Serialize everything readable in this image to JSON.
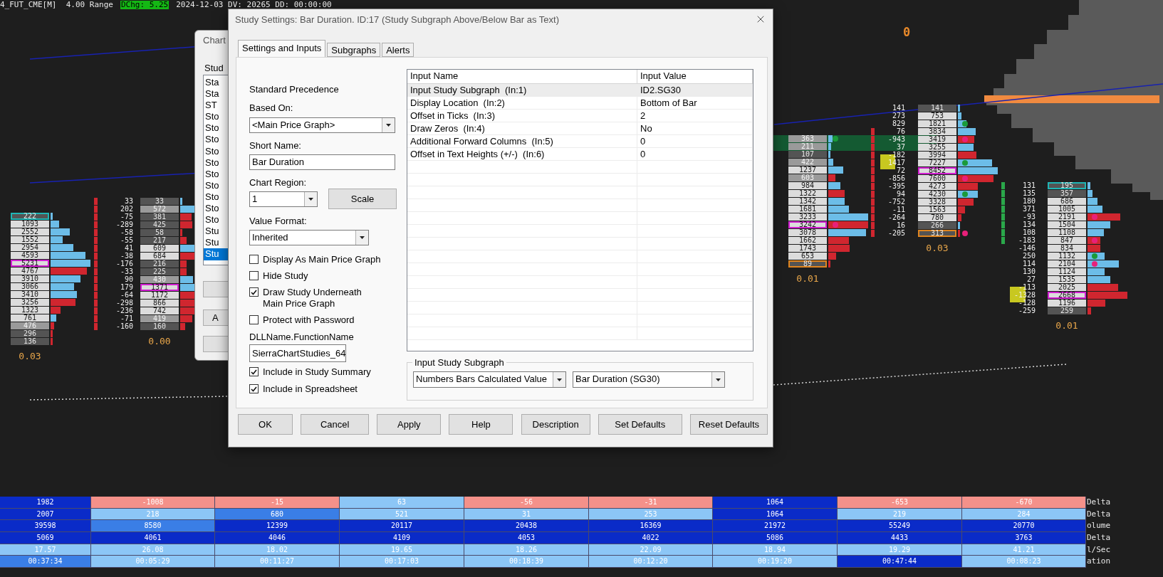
{
  "chart": {
    "header": {
      "symbol": "4_FUT_CME[M]  4.00 Range",
      "change": "DChg: 5.25",
      "info": "2024-12-03 DV: 20265 DD: 00:00:00"
    },
    "marker": "0",
    "footprints": [
      {
        "label": "0.03",
        "rows": [
          {
            "volume": "222",
            "kind": "open",
            "cell": {
              "color": "#545454"
            },
            "bar": {
              "color": "#6cbde8"
            }
          },
          {
            "volume": "1093",
            "kind": "plain",
            "cell": {
              "color": "#dcdcdc"
            },
            "bar": {
              "color": "#6cbde8"
            }
          },
          {
            "volume": "2552",
            "kind": "plain",
            "cell": {
              "color": "#dcdcdc"
            },
            "bar": {
              "color": "#6cbde8"
            }
          },
          {
            "volume": "1552",
            "kind": "plain",
            "cell": {
              "color": "#dcdcdc"
            },
            "bar": {
              "color": "#6cbde8"
            }
          },
          {
            "volume": "2954",
            "kind": "plain",
            "cell": {
              "color": "#dcdcdc"
            },
            "bar": {
              "color": "#6cbde8"
            }
          },
          {
            "volume": "4593",
            "kind": "plain",
            "cell": {
              "color": "#dcdcdc"
            },
            "bar": {
              "color": "#6cbde8"
            }
          },
          {
            "volume": "5231",
            "kind": "poc",
            "cell": {
              "color": "#dcdcdc"
            },
            "bar": {
              "color": "#6cbde8"
            }
          },
          {
            "volume": "4767",
            "kind": "plain",
            "cell": {
              "color": "#dcdcdc"
            },
            "bar": {
              "color": "#d0262f"
            }
          },
          {
            "volume": "3910",
            "kind": "plain",
            "cell": {
              "color": "#dcdcdc"
            },
            "bar": {
              "color": "#6cbde8"
            }
          },
          {
            "volume": "3066",
            "kind": "plain",
            "cell": {
              "color": "#dcdcdc"
            },
            "bar": {
              "color": "#6cbde8"
            }
          },
          {
            "volume": "3410",
            "kind": "plain",
            "cell": {
              "color": "#dcdcdc"
            },
            "bar": {
              "color": "#6cbde8"
            }
          },
          {
            "volume": "3256",
            "kind": "plain",
            "cell": {
              "color": "#dcdcdc"
            },
            "bar": {
              "color": "#d0262f"
            }
          },
          {
            "volume": "1323",
            "kind": "plain",
            "cell": {
              "color": "#dcdcdc"
            },
            "bar": {
              "color": "#d0262f"
            }
          },
          {
            "volume": "761",
            "kind": "plain",
            "cell": {
              "color": "#dcdcdc"
            },
            "bar": {
              "color": "#6cbde8"
            }
          },
          {
            "volume": "476",
            "kind": "plain",
            "cell": {
              "color": "#9a9a9a"
            },
            "bar": {
              "color": "#d0262f"
            }
          },
          {
            "volume": "296",
            "kind": "plain",
            "cell": {
              "color": "#545454"
            },
            "bar": {
              "color": "#d0262f"
            }
          },
          {
            "volume": "136",
            "kind": "plain",
            "cell": {
              "color": "#545454"
            },
            "bar": {
              "color": "#d0262f"
            }
          }
        ]
      },
      {
        "label": "0.00",
        "rows": [
          {
            "delta": "33",
            "volume": "33",
            "kind": "plain",
            "cell": {
              "color": "#545454"
            },
            "bar": {
              "color": "#6cbde8"
            }
          },
          {
            "delta": "202",
            "volume": "572",
            "kind": "plain",
            "cell": {
              "color": "#9a9a9a"
            },
            "bar": {
              "color": "#6cbde8"
            }
          },
          {
            "delta": "-75",
            "volume": "381",
            "kind": "plain",
            "cell": {
              "color": "#545454"
            },
            "bar": {
              "color": "#d0262f"
            }
          },
          {
            "delta": "-289",
            "volume": "425",
            "kind": "plain",
            "cell": {
              "color": "#545454"
            },
            "bar": {
              "color": "#d0262f"
            }
          },
          {
            "delta": "-58",
            "volume": "58",
            "kind": "plain",
            "cell": {
              "color": "#545454"
            },
            "bar": {
              "color": "#d0262f"
            }
          },
          {
            "delta": "-55",
            "volume": "217",
            "kind": "plain",
            "cell": {
              "color": "#545454"
            },
            "bar": {
              "color": "#d0262f"
            }
          },
          {
            "delta": "41",
            "volume": "609",
            "kind": "plain",
            "cell": {
              "color": "#dcdcdc"
            },
            "bar": {
              "color": "#6cbde8"
            }
          },
          {
            "delta": "-38",
            "volume": "684",
            "kind": "plain",
            "cell": {
              "color": "#dcdcdc"
            },
            "bar": {
              "color": "#d0262f"
            }
          },
          {
            "delta": "-176",
            "volume": "216",
            "kind": "plain",
            "cell": {
              "color": "#545454"
            },
            "bar": {
              "color": "#d0262f"
            }
          },
          {
            "delta": "-33",
            "volume": "225",
            "kind": "plain",
            "cell": {
              "color": "#545454"
            },
            "bar": {
              "color": "#d0262f"
            }
          },
          {
            "delta": "90",
            "volume": "430",
            "kind": "plain",
            "cell": {
              "color": "#9a9a9a"
            },
            "bar": {
              "color": "#6cbde8"
            }
          },
          {
            "delta": "179",
            "volume": "1371",
            "kind": "poc",
            "cell": {
              "color": "#dcdcdc"
            },
            "bar": {
              "color": "#6cbde8"
            }
          },
          {
            "delta": "-64",
            "volume": "1172",
            "kind": "plain",
            "cell": {
              "color": "#dcdcdc"
            },
            "bar": {
              "color": "#d0262f"
            }
          },
          {
            "delta": "-298",
            "volume": "866",
            "kind": "plain",
            "cell": {
              "color": "#dcdcdc"
            },
            "bar": {
              "color": "#d0262f"
            }
          },
          {
            "delta": "-236",
            "volume": "742",
            "kind": "plain",
            "cell": {
              "color": "#dcdcdc"
            },
            "bar": {
              "color": "#d0262f"
            }
          },
          {
            "delta": "-71",
            "volume": "419",
            "kind": "plain",
            "cell": {
              "color": "#9a9a9a"
            },
            "bar": {
              "color": "#d0262f"
            }
          },
          {
            "delta": "-160",
            "volume": "160",
            "kind": "plain",
            "cell": {
              "color": "#545454"
            },
            "bar": {
              "color": "#d0262f"
            }
          }
        ]
      },
      {
        "label": "0.01",
        "rows": [
          {
            "volume": "363",
            "kind": "plain",
            "cell": {
              "color": "#9a9a9a"
            },
            "bar": {
              "color": "#6cbde8"
            },
            "dot": {
              "color": "#1a9a3a"
            }
          },
          {
            "volume": "211",
            "kind": "plain",
            "cell": {
              "color": "#9a9a9a"
            },
            "bar": {
              "color": "#6cbde8"
            }
          },
          {
            "volume": "107",
            "kind": "plain",
            "cell": {
              "color": "#545454"
            },
            "bar": {
              "color": "#6cbde8"
            }
          },
          {
            "volume": "422",
            "kind": "plain",
            "cell": {
              "color": "#9a9a9a"
            },
            "bar": {
              "color": "#6cbde8"
            }
          },
          {
            "volume": "1237",
            "kind": "plain",
            "cell": {
              "color": "#dcdcdc"
            },
            "bar": {
              "color": "#6cbde8"
            }
          },
          {
            "volume": "603",
            "kind": "plain",
            "cell": {
              "color": "#9a9a9a"
            },
            "bar": {
              "color": "#d0262f"
            }
          },
          {
            "volume": "984",
            "kind": "plain",
            "cell": {
              "color": "#dcdcdc"
            },
            "bar": {
              "color": "#6cbde8"
            }
          },
          {
            "volume": "1322",
            "kind": "plain",
            "cell": {
              "color": "#dcdcdc"
            },
            "bar": {
              "color": "#d0262f"
            }
          },
          {
            "volume": "1342",
            "kind": "plain",
            "cell": {
              "color": "#dcdcdc"
            },
            "bar": {
              "color": "#6cbde8"
            }
          },
          {
            "volume": "1681",
            "kind": "plain",
            "cell": {
              "color": "#dcdcdc"
            },
            "bar": {
              "color": "#6cbde8"
            }
          },
          {
            "volume": "3233",
            "kind": "plain",
            "cell": {
              "color": "#dcdcdc"
            },
            "bar": {
              "color": "#6cbde8"
            }
          },
          {
            "volume": "3242",
            "kind": "poc",
            "cell": {
              "color": "#dcdcdc"
            },
            "bar": {
              "color": "#d0262f"
            },
            "dot": {
              "color": "#e8207a"
            }
          },
          {
            "volume": "3078",
            "kind": "plain",
            "cell": {
              "color": "#dcdcdc"
            },
            "bar": {
              "color": "#6cbde8"
            }
          },
          {
            "volume": "1662",
            "kind": "plain",
            "cell": {
              "color": "#dcdcdc"
            },
            "bar": {
              "color": "#d0262f"
            }
          },
          {
            "volume": "1743",
            "kind": "plain",
            "cell": {
              "color": "#dcdcdc"
            },
            "bar": {
              "color": "#d0262f"
            }
          },
          {
            "volume": "653",
            "kind": "plain",
            "cell": {
              "color": "#dcdcdc"
            },
            "bar": {
              "color": "#d0262f"
            }
          },
          {
            "volume": "89",
            "kind": "close",
            "cell": {
              "color": "#545454"
            },
            "bar": {
              "color": "#d0262f"
            }
          }
        ]
      },
      {
        "label": "0.03",
        "rows": [
          {
            "delta": "141",
            "volume": "141",
            "kind": "plain",
            "cell": {
              "color": "#545454"
            },
            "bar": {
              "color": "#6cbde8"
            }
          },
          {
            "delta": "273",
            "volume": "753",
            "kind": "plain",
            "cell": {
              "color": "#dcdcdc"
            },
            "bar": {
              "color": "#6cbde8"
            }
          },
          {
            "delta": "829",
            "volume": "1821",
            "kind": "plain",
            "cell": {
              "color": "#dcdcdc"
            },
            "bar": {
              "color": "#6cbde8"
            },
            "dot": {
              "color": "#1a9a3a"
            }
          },
          {
            "delta": "76",
            "volume": "3834",
            "kind": "plain",
            "cell": {
              "color": "#dcdcdc"
            },
            "bar": {
              "color": "#6cbde8"
            }
          },
          {
            "delta": "-943",
            "volume": "3419",
            "kind": "plain",
            "cell": {
              "color": "#dcdcdc"
            },
            "bar": {
              "color": "#d0262f"
            },
            "dot": {
              "color": "#e8207a"
            }
          },
          {
            "delta": "37",
            "volume": "3255",
            "kind": "plain",
            "cell": {
              "color": "#dcdcdc"
            },
            "bar": {
              "color": "#6cbde8"
            }
          },
          {
            "delta": "-182",
            "volume": "3994",
            "kind": "plain",
            "cell": {
              "color": "#dcdcdc"
            },
            "bar": {
              "color": "#d0262f"
            }
          },
          {
            "delta": "1417",
            "volume": "7227",
            "kind": "plain",
            "cell": {
              "color": "#dcdcdc"
            },
            "bar": {
              "color": "#6cbde8"
            },
            "dot": {
              "color": "#1a9a3a"
            }
          },
          {
            "delta": "72",
            "volume": "8452",
            "kind": "poc",
            "cell": {
              "color": "#dcdcdc"
            },
            "bar": {
              "color": "#6cbde8"
            }
          },
          {
            "delta": "-856",
            "volume": "7600",
            "kind": "plain",
            "cell": {
              "color": "#dcdcdc"
            },
            "bar": {
              "color": "#d0262f"
            },
            "dot": {
              "color": "#e8207a"
            }
          },
          {
            "delta": "-395",
            "volume": "4273",
            "kind": "plain",
            "cell": {
              "color": "#dcdcdc"
            },
            "bar": {
              "color": "#d0262f"
            }
          },
          {
            "delta": "94",
            "volume": "4230",
            "kind": "plain",
            "cell": {
              "color": "#dcdcdc"
            },
            "bar": {
              "color": "#6cbde8"
            },
            "dot": {
              "color": "#1a9a3a"
            }
          },
          {
            "delta": "-752",
            "volume": "3328",
            "kind": "plain",
            "cell": {
              "color": "#dcdcdc"
            },
            "bar": {
              "color": "#d0262f"
            }
          },
          {
            "delta": "-11",
            "volume": "1563",
            "kind": "plain",
            "cell": {
              "color": "#dcdcdc"
            },
            "bar": {
              "color": "#d0262f"
            }
          },
          {
            "delta": "-264",
            "volume": "780",
            "kind": "plain",
            "cell": {
              "color": "#dcdcdc"
            },
            "bar": {
              "color": "#d0262f"
            }
          },
          {
            "delta": "16",
            "volume": "266",
            "kind": "plain",
            "cell": {
              "color": "#545454"
            },
            "bar": {
              "color": "#6cbde8"
            }
          },
          {
            "delta": "-205",
            "volume": "313",
            "kind": "close",
            "cell": {
              "color": "#545454"
            },
            "bar": {
              "color": "#d0262f"
            },
            "dot": {
              "color": "#e8207a"
            }
          }
        ]
      },
      {
        "label": "0.01",
        "rows": [
          {
            "delta": "131",
            "volume": "195",
            "kind": "open",
            "cell": {
              "color": "#545454"
            },
            "bar": {
              "color": "#6cbde8"
            }
          },
          {
            "delta": "135",
            "volume": "357",
            "kind": "plain",
            "cell": {
              "color": "#545454"
            },
            "bar": {
              "color": "#6cbde8"
            }
          },
          {
            "delta": "180",
            "volume": "686",
            "kind": "plain",
            "cell": {
              "color": "#dcdcdc"
            },
            "bar": {
              "color": "#6cbde8"
            }
          },
          {
            "delta": "371",
            "volume": "1005",
            "kind": "plain",
            "cell": {
              "color": "#dcdcdc"
            },
            "bar": {
              "color": "#6cbde8"
            }
          },
          {
            "delta": "-93",
            "volume": "2191",
            "kind": "plain",
            "cell": {
              "color": "#dcdcdc"
            },
            "bar": {
              "color": "#d0262f"
            },
            "dot": {
              "color": "#e8207a"
            }
          },
          {
            "delta": "134",
            "volume": "1504",
            "kind": "plain",
            "cell": {
              "color": "#dcdcdc"
            },
            "bar": {
              "color": "#6cbde8"
            }
          },
          {
            "delta": "108",
            "volume": "1108",
            "kind": "plain",
            "cell": {
              "color": "#dcdcdc"
            },
            "bar": {
              "color": "#6cbde8"
            }
          },
          {
            "delta": "-183",
            "volume": "847",
            "kind": "plain",
            "cell": {
              "color": "#dcdcdc"
            },
            "bar": {
              "color": "#d0262f"
            },
            "dot": {
              "color": "#e8207a"
            }
          },
          {
            "delta": "-146",
            "volume": "834",
            "kind": "plain",
            "cell": {
              "color": "#dcdcdc"
            },
            "bar": {
              "color": "#d0262f"
            }
          },
          {
            "delta": "250",
            "volume": "1132",
            "kind": "plain",
            "cell": {
              "color": "#dcdcdc"
            },
            "bar": {
              "color": "#6cbde8"
            },
            "dot": {
              "color": "#1a9a3a"
            }
          },
          {
            "delta": "114",
            "volume": "2104",
            "kind": "plain",
            "cell": {
              "color": "#dcdcdc"
            },
            "bar": {
              "color": "#6cbde8"
            },
            "dot": {
              "color": "#e8207a"
            }
          },
          {
            "delta": "130",
            "volume": "1124",
            "kind": "plain",
            "cell": {
              "color": "#dcdcdc"
            },
            "bar": {
              "color": "#6cbde8"
            }
          },
          {
            "delta": "27",
            "volume": "1535",
            "kind": "plain",
            "cell": {
              "color": "#dcdcdc"
            },
            "bar": {
              "color": "#6cbde8"
            }
          },
          {
            "delta": "-113",
            "volume": "2025",
            "kind": "plain",
            "cell": {
              "color": "#dcdcdc"
            },
            "bar": {
              "color": "#d0262f"
            }
          },
          {
            "delta": "-1328",
            "volume": "2668",
            "kind": "poc",
            "cell": {
              "color": "#dcdcdc"
            },
            "bar": {
              "color": "#d0262f"
            }
          },
          {
            "delta": "-128",
            "volume": "1196",
            "kind": "plain",
            "cell": {
              "color": "#dcdcdc"
            },
            "bar": {
              "color": "#d0262f"
            }
          },
          {
            "delta": "-259",
            "volume": "259",
            "kind": "plain",
            "cell": {
              "color": "#545454"
            },
            "bar": {
              "color": "#d0262f"
            }
          }
        ]
      }
    ]
  },
  "back_dialog": {
    "title": "Chart",
    "label": "Stud",
    "items": [
      {
        "text": "Sta",
        "selected": false
      },
      {
        "text": "Sta",
        "selected": false
      },
      {
        "text": "ST",
        "selected": false
      },
      {
        "text": "Sto",
        "selected": false
      },
      {
        "text": "Sto",
        "selected": false
      },
      {
        "text": "Sto",
        "selected": false
      },
      {
        "text": "Sto",
        "selected": false
      },
      {
        "text": "Sto",
        "selected": false
      },
      {
        "text": "Sto",
        "selected": false
      },
      {
        "text": "Sto",
        "selected": false
      },
      {
        "text": "Sto",
        "selected": false
      },
      {
        "text": "Sto",
        "selected": false
      },
      {
        "text": "Sto",
        "selected": false
      },
      {
        "text": "Stu",
        "selected": false
      },
      {
        "text": "Stu",
        "selected": false
      },
      {
        "text": "Stu",
        "selected": true
      }
    ],
    "button": "A"
  },
  "dialog": {
    "title": "Study Settings: Bar Duration. ID:17 (Study Subgraph Above/Below Bar as Text)",
    "tabs": [
      {
        "label": "Settings and Inputs",
        "selected": true
      },
      {
        "label": "Subgraphs",
        "selected": false
      },
      {
        "label": "Alerts",
        "selected": false
      }
    ],
    "form": {
      "heading": "Standard Precedence",
      "based_on": {
        "label": "Based On:",
        "value": "<Main Price Graph>"
      },
      "short_name": {
        "label": "Short Name:",
        "value": "Bar Duration"
      },
      "chart_region": {
        "label": "Chart Region:",
        "value": "1"
      },
      "scale_button": "Scale",
      "value_format": {
        "label": "Value Format:",
        "value": "Inherited"
      },
      "checkboxes": [
        {
          "label": "Display As Main Price Graph",
          "checked": false
        },
        {
          "label": "Hide Study",
          "checked": false
        },
        {
          "label": "Draw Study Underneath Main Price Graph",
          "checked": true
        },
        {
          "label": "Protect with Password",
          "checked": false
        }
      ],
      "dll": {
        "label": "DLLName.FunctionName",
        "value": "SierraChartStudies_64"
      },
      "checkboxes_2": [
        {
          "label": "Include in Study Summary",
          "checked": true
        },
        {
          "label": "Include in Spreadsheet",
          "checked": true
        }
      ]
    },
    "inputs": {
      "columns": [
        "Input Name",
        "Input Value"
      ],
      "rows": [
        {
          "name": "Input Study Subgraph  (In:1)",
          "value": "ID2.SG30",
          "selected": true
        },
        {
          "name": "Display Location  (In:2)",
          "value": "Bottom of Bar",
          "selected": false
        },
        {
          "name": "Offset in Ticks  (In:3)",
          "value": "2",
          "selected": false
        },
        {
          "name": "Draw Zeros  (In:4)",
          "value": "No",
          "selected": false
        },
        {
          "name": "Additional Forward Columns  (In:5)",
          "value": "0",
          "selected": false
        },
        {
          "name": "Offset in Text Heights (+/-)  (In:6)",
          "value": "0",
          "selected": false
        }
      ]
    },
    "subgraph_group": {
      "title": "Input Study Subgraph",
      "selects": [
        "Numbers Bars Calculated Value",
        "Bar Duration (SG30)"
      ]
    },
    "buttons": [
      "OK",
      "Cancel",
      "Apply",
      "Help",
      "Description",
      "Set Defaults",
      "Reset Defaults"
    ]
  },
  "stats_table": {
    "rows": [
      {
        "label": "Delta",
        "cells": [
          {
            "text": "1982",
            "color": "#0a2bc8"
          },
          {
            "text": "-1008",
            "color": "#f4918a"
          },
          {
            "text": "-15",
            "color": "#f4918a"
          },
          {
            "text": "63",
            "color": "#8cc6f6"
          },
          {
            "text": "-56",
            "color": "#f4918a"
          },
          {
            "text": "-31",
            "color": "#f4918a"
          },
          {
            "text": "1064",
            "color": "#0a2bc8"
          },
          {
            "text": "-653",
            "color": "#f4918a"
          },
          {
            "text": "-670",
            "color": "#f4918a"
          }
        ]
      },
      {
        "label": "Delta",
        "cells": [
          {
            "text": "2007",
            "color": "#0a2bc8"
          },
          {
            "text": "218",
            "color": "#8cc6f6"
          },
          {
            "text": "680",
            "color": "#3a7ee6"
          },
          {
            "text": "521",
            "color": "#8cc6f6"
          },
          {
            "text": "31",
            "color": "#8cc6f6"
          },
          {
            "text": "253",
            "color": "#8cc6f6"
          },
          {
            "text": "1064",
            "color": "#0a2bc8"
          },
          {
            "text": "219",
            "color": "#8cc6f6"
          },
          {
            "text": "284",
            "color": "#8cc6f6"
          }
        ]
      },
      {
        "label": "olume",
        "cells": [
          {
            "text": "39598",
            "color": "#0a2bc8"
          },
          {
            "text": "8580",
            "color": "#3a7ee6"
          },
          {
            "text": "12399",
            "color": "#0a2bc8"
          },
          {
            "text": "20117",
            "color": "#0a2bc8"
          },
          {
            "text": "20438",
            "color": "#0a2bc8"
          },
          {
            "text": "16369",
            "color": "#0a2bc8"
          },
          {
            "text": "21972",
            "color": "#0a2bc8"
          },
          {
            "text": "55249",
            "color": "#0a2bc8"
          },
          {
            "text": "20770",
            "color": "#0a2bc8"
          }
        ]
      },
      {
        "label": "Delta",
        "cells": [
          {
            "text": "5069",
            "color": "#0a2bc8"
          },
          {
            "text": "4061",
            "color": "#0a2bc8"
          },
          {
            "text": "4046",
            "color": "#0a2bc8"
          },
          {
            "text": "4109",
            "color": "#0a2bc8"
          },
          {
            "text": "4053",
            "color": "#0a2bc8"
          },
          {
            "text": "4022",
            "color": "#0a2bc8"
          },
          {
            "text": "5086",
            "color": "#0a2bc8"
          },
          {
            "text": "4433",
            "color": "#0a2bc8"
          },
          {
            "text": "3763",
            "color": "#0a2bc8"
          }
        ]
      },
      {
        "label": "l/Sec",
        "cells": [
          {
            "text": "17.57",
            "color": "#8cc6f6"
          },
          {
            "text": "26.08",
            "color": "#8cc6f6"
          },
          {
            "text": "18.02",
            "color": "#8cc6f6"
          },
          {
            "text": "19.65",
            "color": "#8cc6f6"
          },
          {
            "text": "18.26",
            "color": "#8cc6f6"
          },
          {
            "text": "22.09",
            "color": "#8cc6f6"
          },
          {
            "text": "18.94",
            "color": "#8cc6f6"
          },
          {
            "text": "19.29",
            "color": "#8cc6f6"
          },
          {
            "text": "41.21",
            "color": "#8cc6f6"
          }
        ]
      },
      {
        "label": "ation",
        "cells": [
          {
            "text": "00:37:34",
            "color": "#3a7ee6"
          },
          {
            "text": "00:05:29",
            "color": "#8cc6f6"
          },
          {
            "text": "00:11:27",
            "color": "#8cc6f6"
          },
          {
            "text": "00:17:03",
            "color": "#8cc6f6"
          },
          {
            "text": "00:18:39",
            "color": "#8cc6f6"
          },
          {
            "text": "00:12:20",
            "color": "#8cc6f6"
          },
          {
            "text": "00:19:20",
            "color": "#8cc6f6"
          },
          {
            "text": "00:47:44",
            "color": "#0a2bc8"
          },
          {
            "text": "00:08:23",
            "color": "#8cc6f6"
          }
        ]
      }
    ]
  }
}
